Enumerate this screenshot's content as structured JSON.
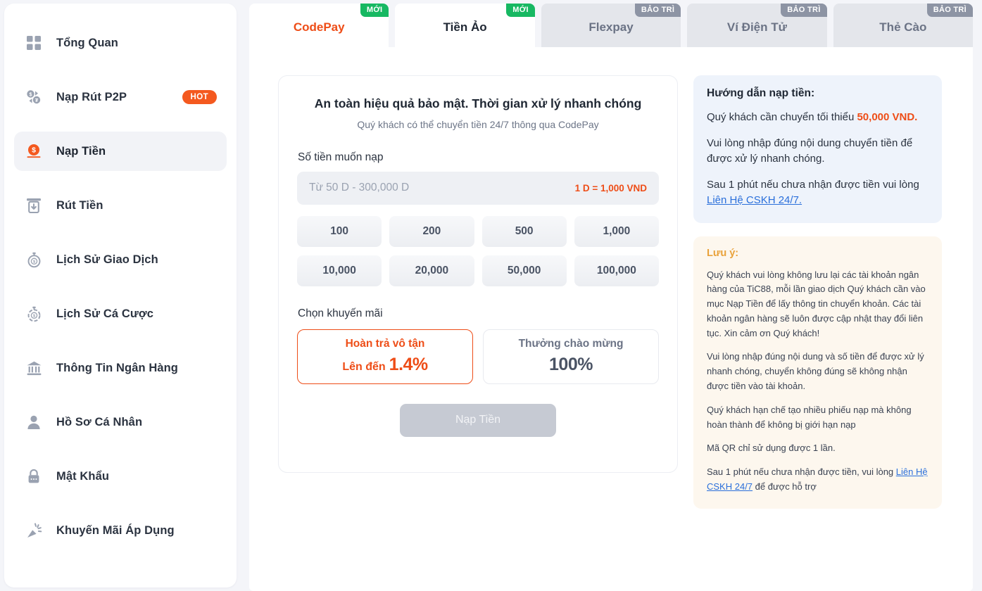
{
  "sidebar": {
    "items": [
      {
        "label": "Tổng Quan",
        "icon": "grid-icon",
        "active": false,
        "badge": null
      },
      {
        "label": "Nạp Rút P2P",
        "icon": "p2p-exchange-icon",
        "active": false,
        "badge": "HOT"
      },
      {
        "label": "Nạp Tiền",
        "icon": "deposit-coin-icon",
        "active": true,
        "badge": null
      },
      {
        "label": "Rút Tiền",
        "icon": "withdraw-atm-icon",
        "active": false,
        "badge": null
      },
      {
        "label": "Lịch Sử Giao Dịch",
        "icon": "transaction-history-icon",
        "active": false,
        "badge": null
      },
      {
        "label": "Lịch Sử Cá Cược",
        "icon": "bet-history-icon",
        "active": false,
        "badge": null
      },
      {
        "label": "Thông Tin Ngân Hàng",
        "icon": "bank-icon",
        "active": false,
        "badge": null
      },
      {
        "label": "Hồ Sơ Cá Nhân",
        "icon": "user-profile-icon",
        "active": false,
        "badge": null
      },
      {
        "label": "Mật Khẩu",
        "icon": "lock-icon",
        "active": false,
        "badge": null
      },
      {
        "label": "Khuyến Mãi Áp Dụng",
        "icon": "promotion-confetti-icon",
        "active": false,
        "badge": null
      }
    ]
  },
  "tabs": [
    {
      "label": "CodePay",
      "badge": "MỚI",
      "badge_type": "new",
      "state": "enabled",
      "accent": true
    },
    {
      "label": "Tiền Ảo",
      "badge": "MỚI",
      "badge_type": "new",
      "state": "active",
      "accent": false
    },
    {
      "label": "Flexpay",
      "badge": "BẢO TRÌ",
      "badge_type": "maint",
      "state": "disabled",
      "accent": false
    },
    {
      "label": "Ví Điện Tử",
      "badge": "BẢO TRÌ",
      "badge_type": "maint",
      "state": "disabled",
      "accent": false
    },
    {
      "label": "Thẻ Cào",
      "badge": "BẢO TRÌ",
      "badge_type": "maint",
      "state": "disabled",
      "accent": false
    }
  ],
  "deposit": {
    "title": "An toàn hiệu quả bảo mật. Thời gian xử lý nhanh chóng",
    "subtitle": "Quý khách có thể chuyển tiền 24/7 thông qua CodePay",
    "amount_label": "Số tiền muốn nạp",
    "amount_value": "",
    "amount_placeholder": "Từ 50 D - 300,000 D",
    "rate_text": "1 D = 1,000 VND",
    "quick_amounts": [
      "100",
      "200",
      "500",
      "1,000",
      "10,000",
      "20,000",
      "50,000",
      "100,000"
    ],
    "promo_label": "Chọn khuyến mãi",
    "promos": [
      {
        "title": "Hoàn trả vô tận",
        "prefix": "Lên đến",
        "value": "1.4%",
        "selected": true
      },
      {
        "title": "Thưởng chào mừng",
        "prefix": "",
        "value": "100%",
        "selected": false
      }
    ],
    "submit_label": "Nạp Tiền"
  },
  "guide": {
    "title": "Hướng dẫn nạp tiền:",
    "p1_before": "Quý khách cần chuyển tối thiểu ",
    "p1_strong": "50,000 VND.",
    "p2": "Vui lòng nhập đúng nội dung chuyển tiền để được xử lý nhanh chóng.",
    "p3_before": "Sau 1 phút nếu chưa nhận được tiền vui lòng ",
    "p3_link": "Liên Hệ CSKH 24/7."
  },
  "note": {
    "title": "Lưu ý:",
    "p1": "Quý khách vui lòng không lưu lại các tài khoản ngân hàng của TiC88, mỗi lần giao dịch Quý khách cần vào mục Nạp Tiền để lấy thông tin chuyển khoản. Các tài khoản ngân hàng sẽ luôn được cập nhật thay đổi liên tục. Xin cảm ơn Quý khách!",
    "p2": "Vui lòng nhập đúng nội dung và số tiền để được xử lý nhanh chóng, chuyển không đúng sẽ không nhận được tiền vào tài khoản.",
    "p3": "Quý khách hạn chế tạo nhiều phiếu nạp mà không hoàn thành để không bị giới hạn nạp",
    "p4": "Mã QR chỉ sử dụng được 1 lần.",
    "p5_before": "Sau 1 phút nếu chưa nhận được tiền, vui lòng ",
    "p5_link": "Liên Hệ CSKH 24/7",
    "p5_after": " để được hỗ trợ"
  },
  "colors": {
    "accent_orange": "#ee4d17",
    "badge_new_green": "#17b862",
    "badge_maint_gray": "#8d94a4",
    "link_blue": "#2a6fdb",
    "note_amber": "#e9a23b",
    "page_bg": "#f4f5f9"
  }
}
